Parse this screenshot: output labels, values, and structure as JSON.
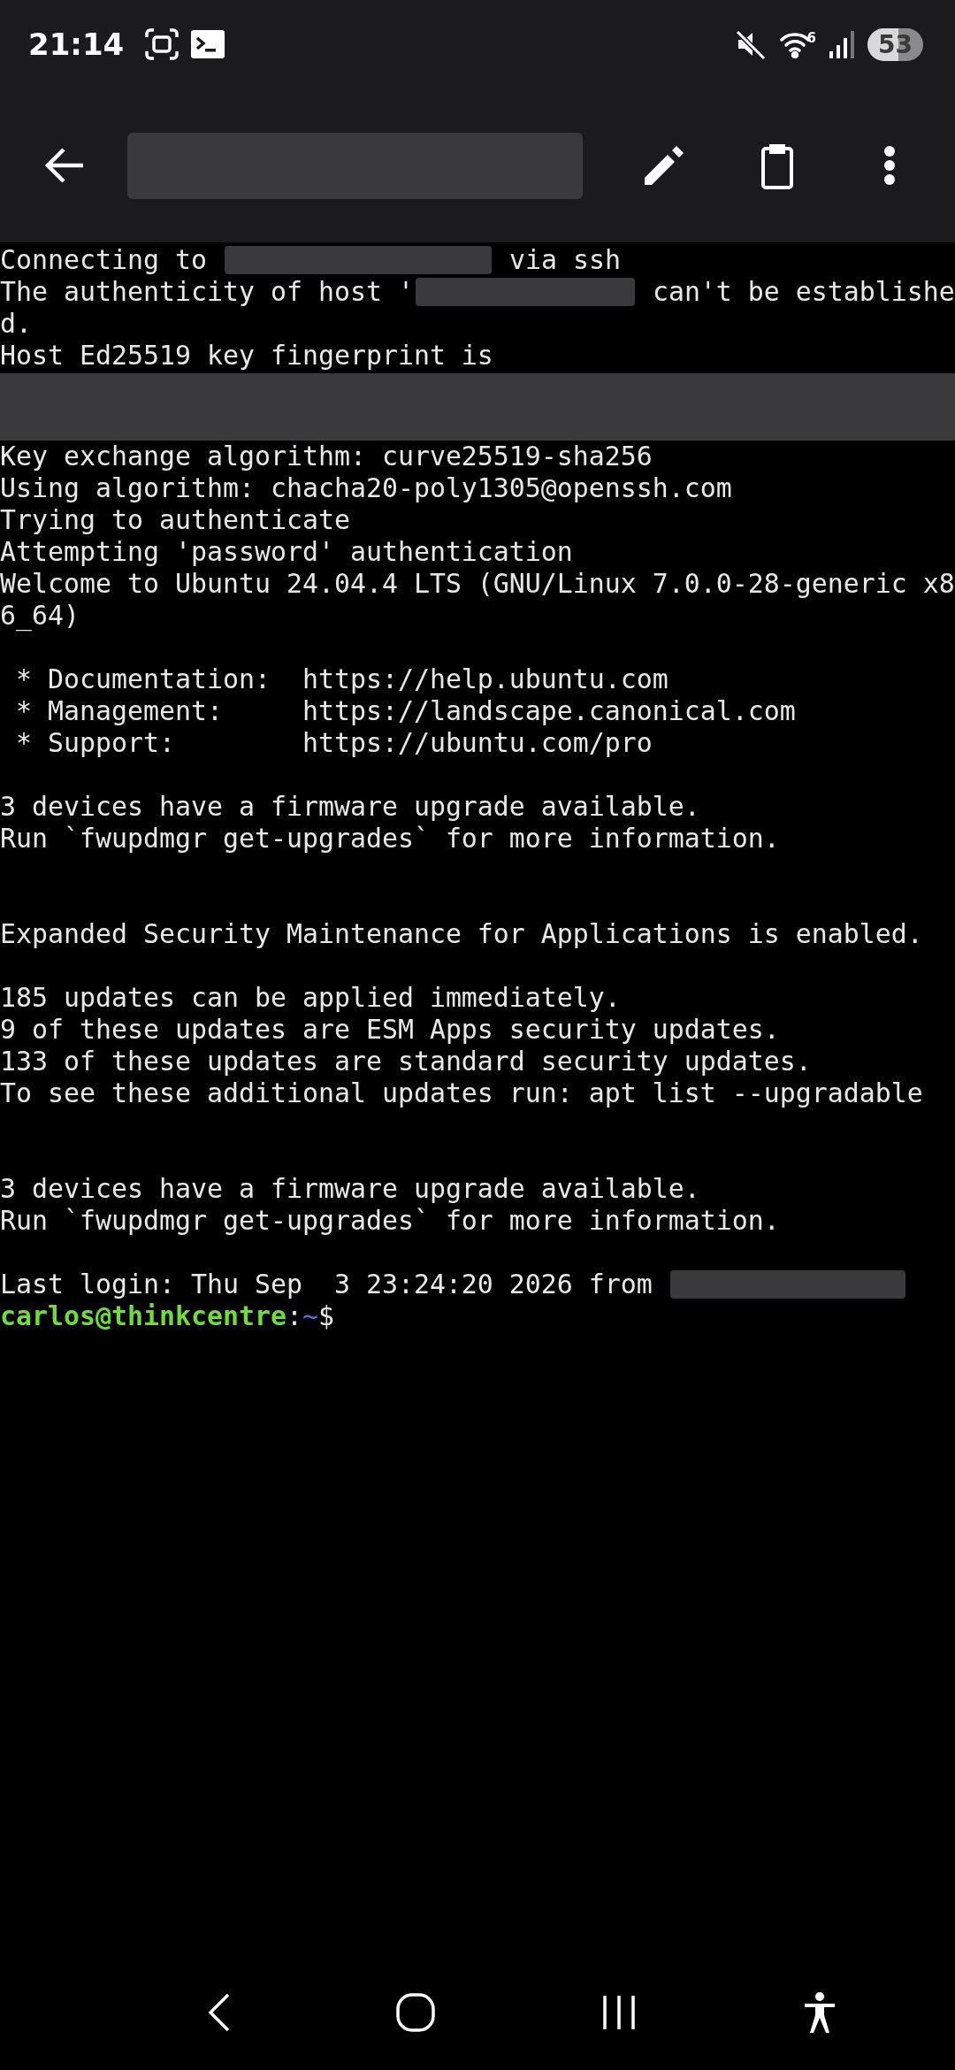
{
  "status_bar": {
    "time": "21:14",
    "wifi_badge": "6",
    "battery": "53"
  },
  "terminal": {
    "lines": [
      {
        "kind": "text",
        "segments": [
          {
            "kind": "text",
            "text": "Connecting to "
          },
          {
            "kind": "redacted"
          },
          {
            "kind": "text",
            "text": " via ssh"
          }
        ]
      },
      {
        "kind": "text",
        "segments": [
          {
            "kind": "text",
            "text": "The authenticity of host '"
          },
          {
            "kind": "redacted"
          },
          {
            "kind": "text",
            "text": " can't be establishe"
          }
        ]
      },
      {
        "kind": "text",
        "segments": [
          {
            "kind": "text",
            "text": "d."
          }
        ]
      },
      {
        "kind": "text",
        "segments": [
          {
            "kind": "text",
            "text": "Host Ed25519 key fingerprint is"
          }
        ]
      },
      {
        "kind": "redacted-block"
      },
      {
        "kind": "text",
        "segments": [
          {
            "kind": "text",
            "text": "Key exchange algorithm: curve25519-sha256"
          }
        ]
      },
      {
        "kind": "text",
        "segments": [
          {
            "kind": "text",
            "text": "Using algorithm: chacha20-poly1305@openssh.com"
          }
        ]
      },
      {
        "kind": "text",
        "segments": [
          {
            "kind": "text",
            "text": "Trying to authenticate"
          }
        ]
      },
      {
        "kind": "text",
        "segments": [
          {
            "kind": "text",
            "text": "Attempting 'password' authentication"
          }
        ]
      },
      {
        "kind": "text",
        "segments": [
          {
            "kind": "text",
            "text": "Welcome to Ubuntu 24.04.4 LTS (GNU/Linux 7.0.0-28-generic x8"
          }
        ]
      },
      {
        "kind": "text",
        "segments": [
          {
            "kind": "text",
            "text": "6_64)"
          }
        ]
      },
      {
        "kind": "blank"
      },
      {
        "kind": "text",
        "segments": [
          {
            "kind": "text",
            "text": " * Documentation:  https://help.ubuntu.com"
          }
        ]
      },
      {
        "kind": "text",
        "segments": [
          {
            "kind": "text",
            "text": " * Management:     https://landscape.canonical.com"
          }
        ]
      },
      {
        "kind": "text",
        "segments": [
          {
            "kind": "text",
            "text": " * Support:        https://ubuntu.com/pro"
          }
        ]
      },
      {
        "kind": "blank"
      },
      {
        "kind": "text",
        "segments": [
          {
            "kind": "text",
            "text": "3 devices have a firmware upgrade available."
          }
        ]
      },
      {
        "kind": "text",
        "segments": [
          {
            "kind": "text",
            "text": "Run `fwupdmgr get-upgrades` for more information."
          }
        ]
      },
      {
        "kind": "blank"
      },
      {
        "kind": "blank"
      },
      {
        "kind": "text",
        "segments": [
          {
            "kind": "text",
            "text": "Expanded Security Maintenance for Applications is enabled."
          }
        ]
      },
      {
        "kind": "blank"
      },
      {
        "kind": "text",
        "segments": [
          {
            "kind": "text",
            "text": "185 updates can be applied immediately."
          }
        ]
      },
      {
        "kind": "text",
        "segments": [
          {
            "kind": "text",
            "text": "9 of these updates are ESM Apps security updates."
          }
        ]
      },
      {
        "kind": "text",
        "segments": [
          {
            "kind": "text",
            "text": "133 of these updates are standard security updates."
          }
        ]
      },
      {
        "kind": "text",
        "segments": [
          {
            "kind": "text",
            "text": "To see these additional updates run: apt list --upgradable"
          }
        ]
      },
      {
        "kind": "blank"
      },
      {
        "kind": "blank"
      },
      {
        "kind": "text",
        "segments": [
          {
            "kind": "text",
            "text": "3 devices have a firmware upgrade available."
          }
        ]
      },
      {
        "kind": "text",
        "segments": [
          {
            "kind": "text",
            "text": "Run `fwupdmgr get-upgrades` for more information."
          }
        ]
      },
      {
        "kind": "blank"
      },
      {
        "kind": "text",
        "segments": [
          {
            "kind": "text",
            "text": "Last login: Thu Sep  3 23:24:20 2026 from "
          },
          {
            "kind": "redacted"
          }
        ]
      },
      {
        "kind": "text",
        "segments": [
          {
            "kind": "user",
            "text": "carlos@thinkcentre"
          },
          {
            "kind": "text",
            "text": ":"
          },
          {
            "kind": "path",
            "text": "~"
          },
          {
            "kind": "text",
            "text": "$"
          }
        ]
      }
    ]
  }
}
